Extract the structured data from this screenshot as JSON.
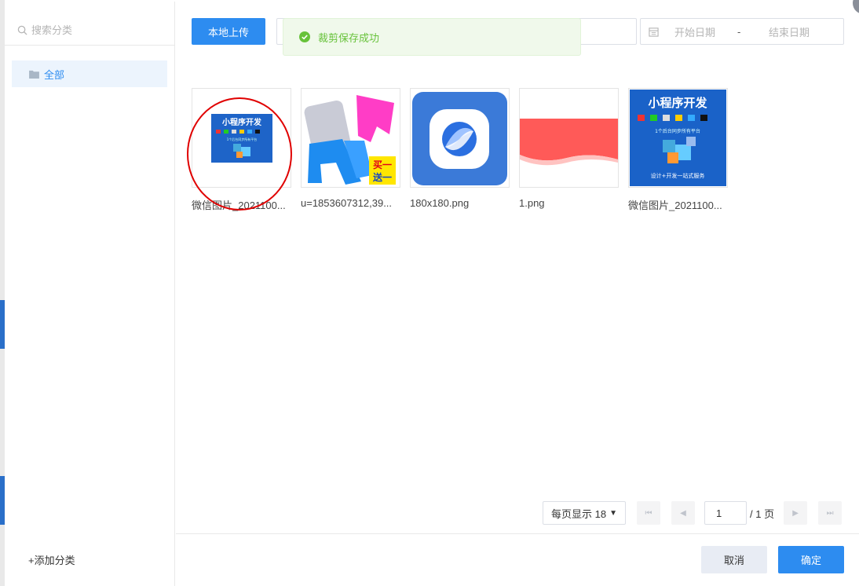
{
  "sidebar": {
    "search_placeholder": "搜索分类",
    "categories": [
      {
        "label": "全部"
      }
    ],
    "add_category": "+添加分类"
  },
  "toolbar": {
    "upload_label": "本地上传",
    "date_start_placeholder": "开始日期",
    "date_separator": "-",
    "date_end_placeholder": "结束日期"
  },
  "toast": {
    "message": "裁剪保存成功"
  },
  "images": [
    {
      "name": "微信图片_2021100...",
      "banner_title": "小程序开发",
      "banner_sub": "1个后台同步所有平台"
    },
    {
      "name": "u=1853607312,39...",
      "badge_line1": "买一",
      "badge_line2": "送一"
    },
    {
      "name": "180x180.png"
    },
    {
      "name": "1.png"
    },
    {
      "name": "微信图片_2021100...",
      "banner_title": "小程序开发",
      "banner_sub": "1个后台同步所有平台",
      "banner_footer": "设计+开发一站式服务"
    }
  ],
  "pagination": {
    "page_size_label": "每页显示 18",
    "current_page": "1",
    "total_label": "/ 1 页"
  },
  "footer": {
    "cancel_label": "取消",
    "ok_label": "确定"
  },
  "colors": {
    "primary": "#2d8cf0",
    "success": "#67c23a",
    "annotation": "#e00000"
  }
}
